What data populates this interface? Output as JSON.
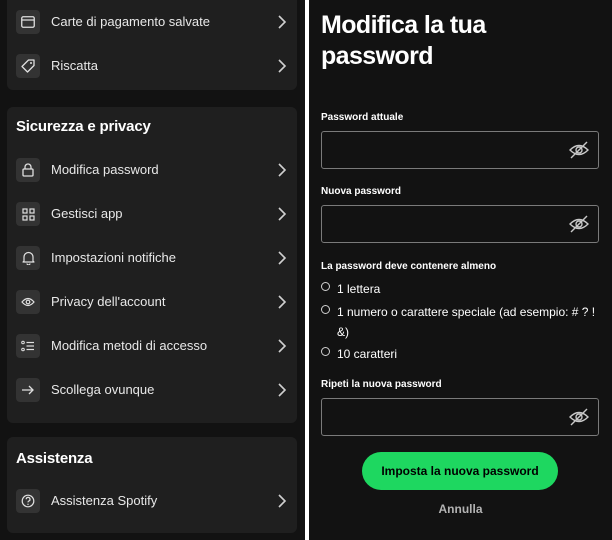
{
  "account_menu": {
    "top_items": [
      {
        "label": "Carte di pagamento salvate",
        "icon": "card-icon"
      },
      {
        "label": "Riscatta",
        "icon": "tag-icon"
      }
    ],
    "security": {
      "title": "Sicurezza e privacy",
      "items": [
        {
          "label": "Modifica password",
          "icon": "lock-icon"
        },
        {
          "label": "Gestisci app",
          "icon": "apps-grid-icon"
        },
        {
          "label": "Impostazioni notifiche",
          "icon": "bell-icon"
        },
        {
          "label": "Privacy dell'account",
          "icon": "eye-icon"
        },
        {
          "label": "Modifica metodi di accesso",
          "icon": "list-icon"
        },
        {
          "label": "Scollega ovunque",
          "icon": "arrow-right-icon"
        }
      ]
    },
    "support": {
      "title": "Assistenza",
      "items": [
        {
          "label": "Assistenza Spotify",
          "icon": "help-icon"
        }
      ]
    }
  },
  "change_password": {
    "title": "Modifica la tua password",
    "current_password": {
      "label": "Password attuale",
      "value": "",
      "placeholder": ""
    },
    "new_password": {
      "label": "Nuova password",
      "value": "",
      "placeholder": ""
    },
    "requirements": {
      "title": "La password deve contenere almeno",
      "items": [
        "1 lettera",
        "1 numero o carattere speciale (ad esempio: # ? ! &)",
        "10 caratteri"
      ]
    },
    "repeat_password": {
      "label": "Ripeti la nuova password",
      "value": "",
      "placeholder": ""
    },
    "submit_label": "Imposta la nuova password",
    "cancel_label": "Annulla"
  },
  "colors": {
    "accent": "#1ed760",
    "background": "#121212",
    "card": "#1f1f1f",
    "text": "#ffffff",
    "muted": "#b3b3b3"
  }
}
